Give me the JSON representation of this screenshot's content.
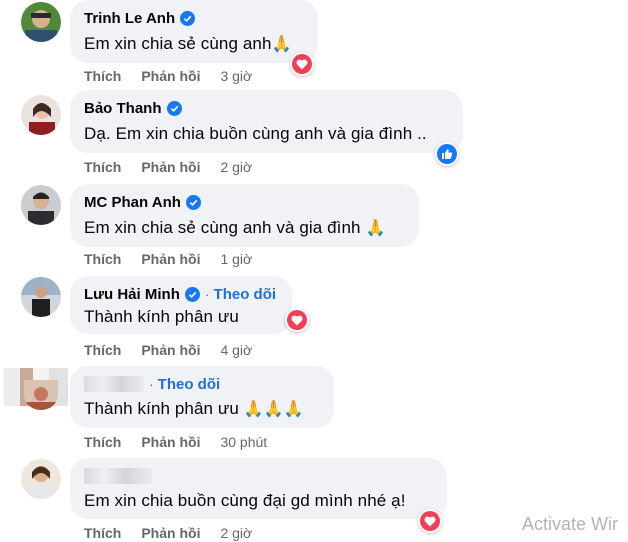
{
  "comments": [
    {
      "name": "Trinh Le Anh",
      "verified": true,
      "follow": "",
      "text": "Em xin chia sẻ cùng anh",
      "emoji": "🙏",
      "like": "Thích",
      "reply": "Phản hồi",
      "time": "3 giờ",
      "reaction": "heart-icon"
    },
    {
      "name": "Bảo Thanh",
      "verified": true,
      "follow": "",
      "text": "Dạ. Em xin chia buồn cùng anh và gia đình ..",
      "emoji": "",
      "like": "Thích",
      "reply": "Phản hồi",
      "time": "2 giờ",
      "reaction": "like-icon"
    },
    {
      "name": "MC Phan Anh",
      "verified": true,
      "follow": "",
      "text": "Em xin chia sẻ cùng anh và gia đình ",
      "emoji": "🙏",
      "like": "Thích",
      "reply": "Phản hồi",
      "time": "1 giờ",
      "reaction": ""
    },
    {
      "name": "Lưu Hải Minh",
      "verified": true,
      "follow": "Theo dõi",
      "text": "Thành kính phân ưu",
      "emoji": "",
      "like": "Thích",
      "reply": "Phản hồi",
      "time": "4 giờ",
      "reaction": "heart-icon"
    },
    {
      "name": "",
      "verified": false,
      "follow": "Theo dõi",
      "text": "Thành kính phân ưu ",
      "emoji": "🙏🙏🙏",
      "like": "Thích",
      "reply": "Phản hồi",
      "time": "30 phút",
      "reaction": ""
    },
    {
      "name": "",
      "verified": false,
      "follow": "",
      "text": "Em xin chia buồn cùng đại gd mình nhé ạ!",
      "emoji": "",
      "like": "Thích",
      "reply": "Phản hồi",
      "time": "2 giờ",
      "reaction": "heart-icon"
    }
  ],
  "separator": "·",
  "watermark": "Activate Wir",
  "colors": {
    "bubble": "#f0f2f5",
    "verified": "#1877f2",
    "heart": "#f33e58",
    "follow": "#216fdb",
    "meta": "#65676b"
  }
}
